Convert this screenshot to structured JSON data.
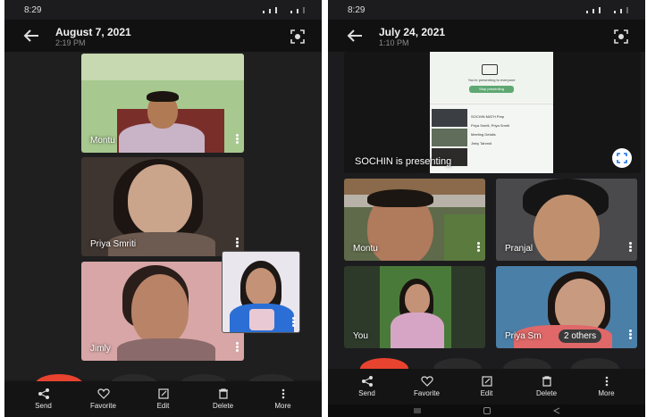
{
  "left": {
    "status_time": "8:29",
    "title": "August 7, 2021",
    "subtitle": "2:19 PM",
    "tiles": [
      {
        "name": "Montu"
      },
      {
        "name": "Priya Smriti"
      },
      {
        "name": "Jimly"
      }
    ],
    "actions": [
      {
        "label": "Send",
        "icon": "share-icon"
      },
      {
        "label": "Favorite",
        "icon": "heart-icon"
      },
      {
        "label": "Edit",
        "icon": "edit-icon"
      },
      {
        "label": "Delete",
        "icon": "trash-icon"
      },
      {
        "label": "More",
        "icon": "more-icon"
      }
    ]
  },
  "right": {
    "status_time": "8:29",
    "title": "July 24, 2021",
    "subtitle": "1:10 PM",
    "presenting_label": "SOCHIN is presenting",
    "shared_screen": {
      "text1": "You're presenting to everyone",
      "button": "Stop presenting",
      "rows": [
        "SOCHIN MATH Prep",
        "Priya Smriti, Priya Smriti",
        "Meeting Details",
        "Jimly Tahmid"
      ]
    },
    "tiles": [
      {
        "name": "Montu"
      },
      {
        "name": "Pranjal"
      },
      {
        "name": "You"
      },
      {
        "name": "Priya Sm"
      }
    ],
    "others_label": "2 others",
    "actions": [
      {
        "label": "Send",
        "icon": "share-icon"
      },
      {
        "label": "Favorite",
        "icon": "heart-icon"
      },
      {
        "label": "Edit",
        "icon": "edit-icon"
      },
      {
        "label": "Delete",
        "icon": "trash-icon"
      },
      {
        "label": "More",
        "icon": "more-icon"
      }
    ]
  }
}
